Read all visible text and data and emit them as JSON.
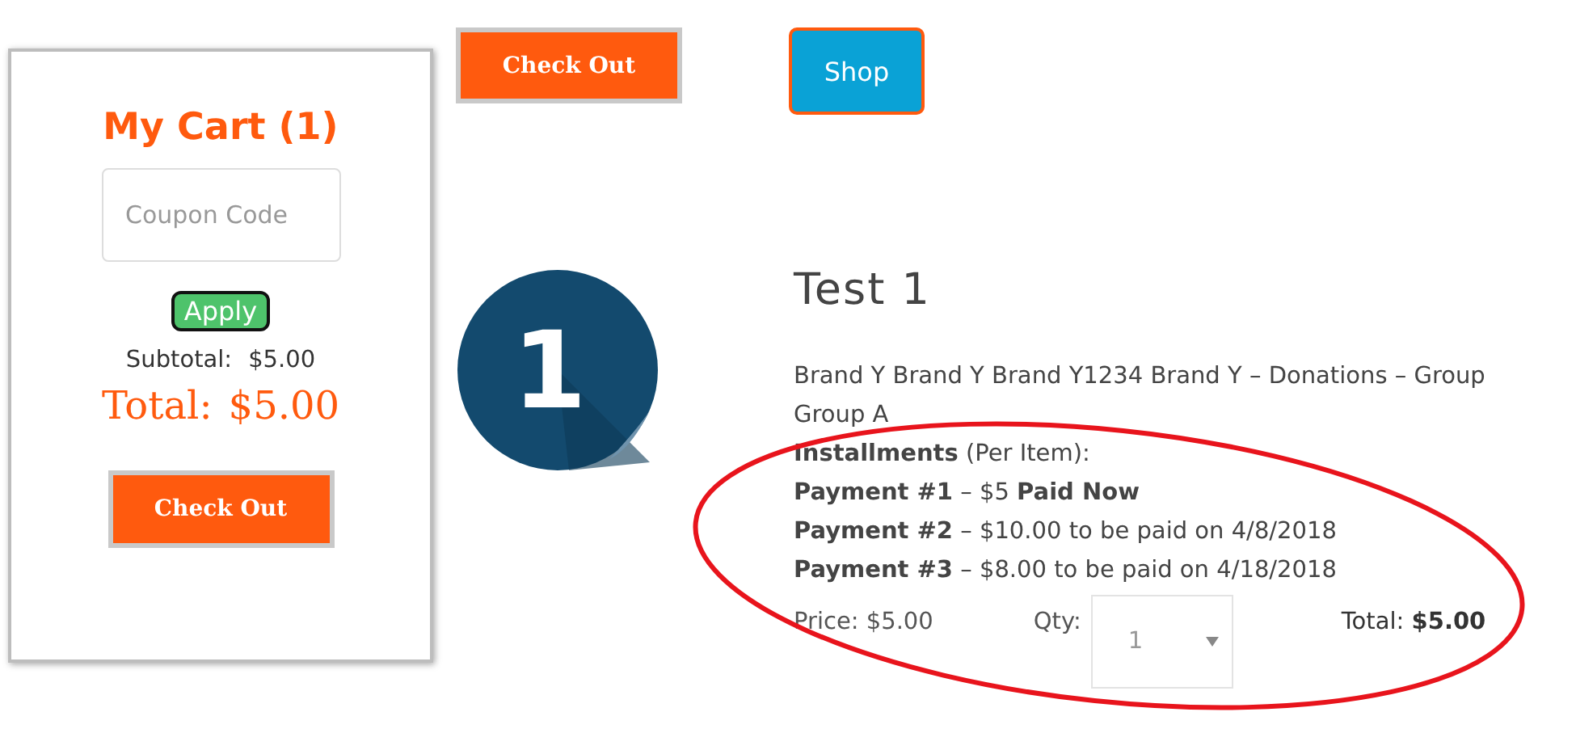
{
  "cart": {
    "title": "My Cart (1)",
    "coupon_placeholder": "Coupon Code",
    "apply_button": "Apply",
    "subtotal_label": "Subtotal:",
    "subtotal_value": "$5.00",
    "total_label": "Total:",
    "total_value": "$5.00",
    "checkout_button": "Check Out"
  },
  "top_buttons": [
    {
      "kind": "checkout",
      "label": "Check Out"
    },
    {
      "kind": "shop",
      "label": "Shop"
    }
  ],
  "product": {
    "badge": "1",
    "title": "Test 1",
    "description": [
      "Brand Y Brand Y Brand Y1234 Brand Y – Donations – Group",
      "Group A"
    ],
    "installments": "**Installments** (Per Item):",
    "payments": [
      "**Payment #1** – $5 **Paid Now**",
      "**Payment #2** – $10.00 to be paid on 4/8/2018",
      "**Payment #3** – $8.00 to be paid on 4/18/2018"
    ],
    "price": "Price: $5.00",
    "qty_label": "Qty:",
    "qty_value": "1",
    "total": "Total: **$5.00**"
  }
}
